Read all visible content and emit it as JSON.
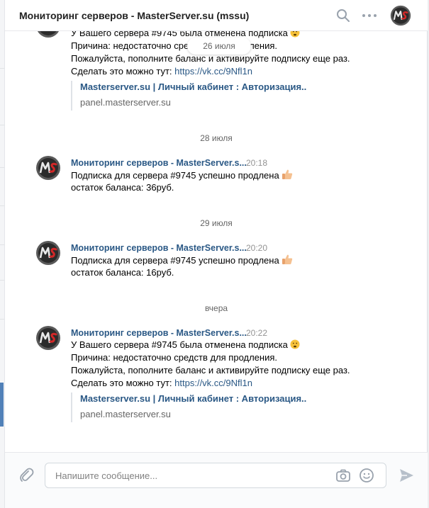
{
  "header": {
    "title": "Мониторинг серверов - MasterServer.su (mssu)"
  },
  "date_pill": "26 июля",
  "first_message": {
    "line1": "У Вашего сервера #9745 была отменена подписка",
    "line2": "Причина: недостаточно средств для продления.",
    "line3": "Пожалуйста, пополните баланс и активируйте подписку еще раз.",
    "line4_prefix": "Сделать это можно тут: ",
    "link": "https://vk.cc/9Nfl1n",
    "snippet_title": "Masterserver.su | Личный кабинет : Авторизация..",
    "snippet_domain": "panel.masterserver.su"
  },
  "groups": [
    {
      "date": "28 июля",
      "sender": "Мониторинг серверов - MasterServer.s...",
      "time": "20:18",
      "line1": "Подписка для сервера #9745 успешно продлена",
      "line2": "остаток баланса: 36руб."
    },
    {
      "date": "29 июля",
      "sender": "Мониторинг серверов - MasterServer.s...",
      "time": "20:20",
      "line1": "Подписка для сервера #9745 успешно продлена",
      "line2": "остаток баланса: 16руб."
    },
    {
      "date": "вчера",
      "sender": "Мониторинг серверов - MasterServer.s...",
      "time": "20:22",
      "line1": "У Вашего сервера #9745 была отменена подписка",
      "line2": "Причина: недостаточно средств для продления.",
      "line3": "Пожалуйста, пополните баланс и активируйте подписку еще раз.",
      "line4_prefix": "Сделать это можно тут: ",
      "link": "https://vk.cc/9Nfl1n",
      "snippet_title": "Masterserver.su | Личный кабинет : Авторизация..",
      "snippet_domain": "panel.masterserver.su"
    }
  ],
  "composer": {
    "placeholder": "Напишите сообщение..."
  },
  "colors": {
    "link": "#2a5885",
    "accent": "#5181b8",
    "meta": "#939393"
  },
  "icons": [
    "search-icon",
    "more-icon",
    "attach-icon",
    "camera-icon",
    "smile-icon",
    "send-icon",
    "thumbs-up-icon",
    "sad-face-icon"
  ]
}
